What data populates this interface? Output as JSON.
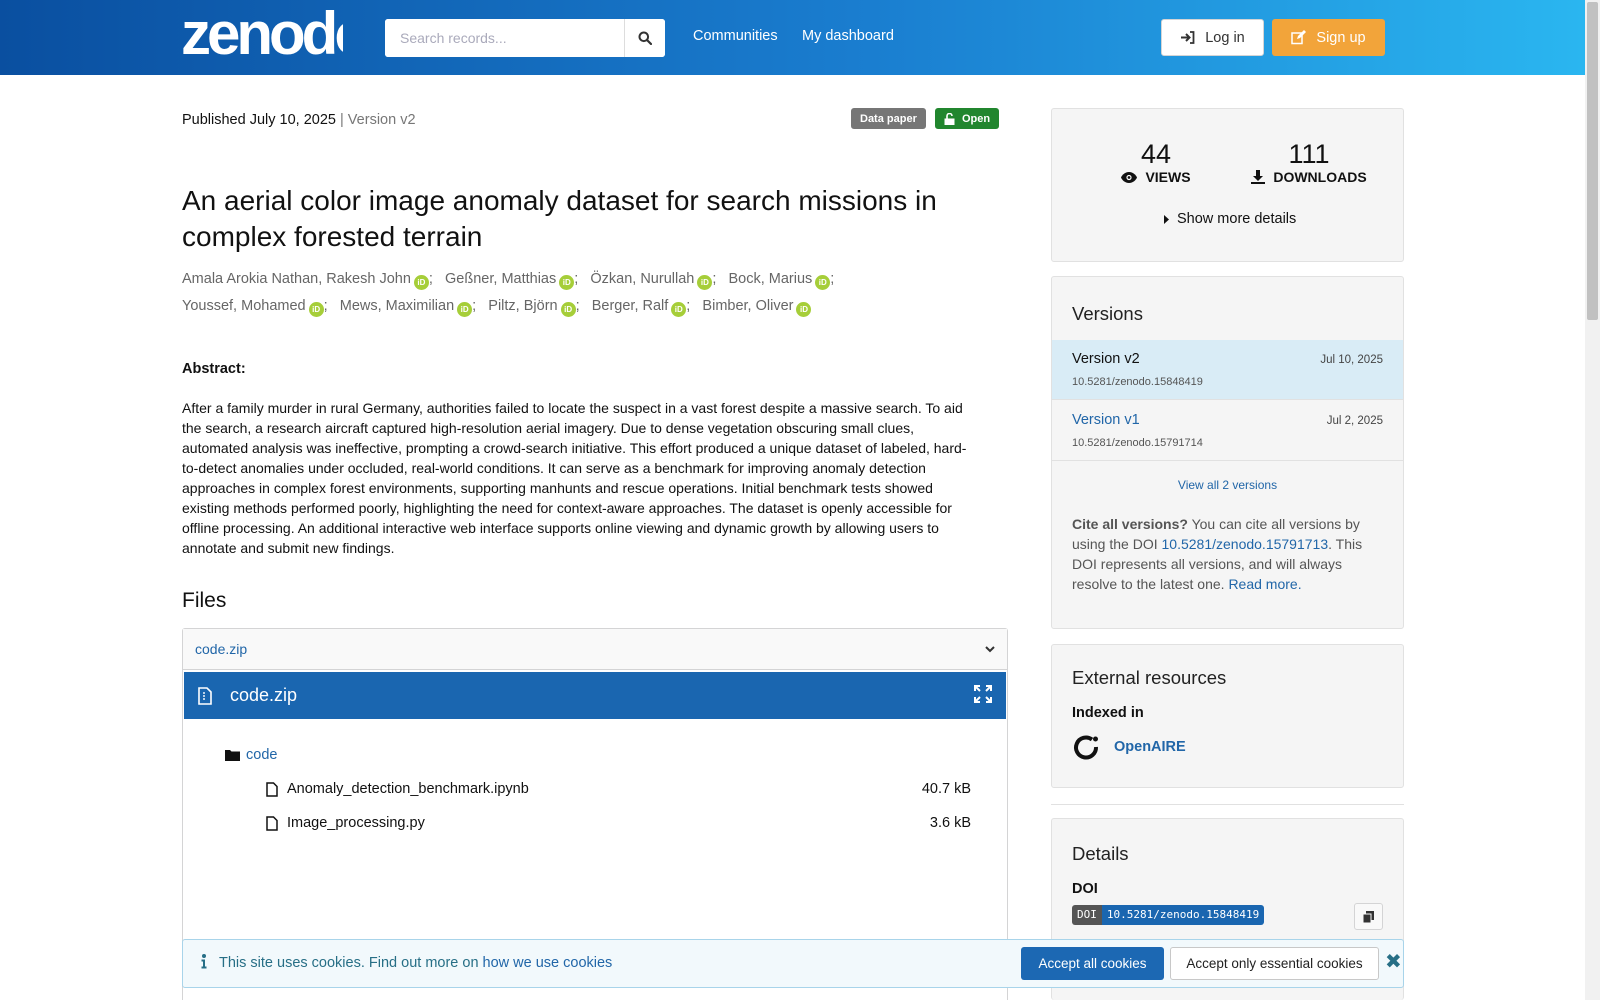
{
  "header": {
    "logo_text": "zenodo",
    "search_placeholder": "Search records...",
    "nav": [
      "Communities",
      "My dashboard"
    ],
    "login_label": "Log in",
    "signup_label": "Sign up"
  },
  "record": {
    "published": "Published July 10, 2025",
    "version": "| Version v2",
    "type_badge": "Data paper",
    "access_badge": "Open",
    "title": "An aerial color image anomaly dataset for search missions in complex forested terrain",
    "authors": [
      "Amala Arokia Nathan, Rakesh John",
      "Geßner, Matthias",
      "Özkan, Nurullah",
      "Bock, Marius",
      "Youssef, Mohamed",
      "Mews, Maximilian",
      "Piltz, Björn",
      "Berger, Ralf",
      "Bimber, Oliver"
    ],
    "abstract_label": "Abstract:",
    "abstract": "After a family murder in rural Germany, authorities failed to locate the suspect in a vast forest despite a massive search. To aid the search, a research aircraft captured high-resolution aerial imagery. Due to dense vegetation obscuring small clues, automated analysis was ineffective, prompting a crowd-search initiative. This effort produced a unique dataset of labeled, hard-to-detect anomalies under occluded, real-world conditions. It can serve as a benchmark for improving anomaly detection approaches in complex forest environments, supporting manhunts and rescue operations. Initial benchmark tests showed existing methods performed poorly, highlighting the need for context-aware approaches. The dataset is openly accessible for offline processing. An additional interactive web interface supports online viewing and dynamic growth by allowing users to annotate and submit new findings."
  },
  "files": {
    "heading": "Files",
    "accordion_label": "code.zip",
    "preview_title": "code.zip",
    "folder": "code",
    "items": [
      {
        "name": "Anomaly_detection_benchmark.ipynb",
        "size": "40.7 kB"
      },
      {
        "name": "Image_processing.py",
        "size": "3.6 kB"
      }
    ]
  },
  "stats": {
    "views": "44",
    "views_label": "VIEWS",
    "downloads": "111",
    "downloads_label": "DOWNLOADS",
    "more": "Show more details"
  },
  "versions": {
    "heading": "Versions",
    "list": [
      {
        "name": "Version v2",
        "date": "Jul 10, 2025",
        "doi": "10.5281/zenodo.15848419"
      },
      {
        "name": "Version v1",
        "date": "Jul 2, 2025",
        "doi": "10.5281/zenodo.15791714"
      }
    ],
    "view_all": "View all 2 versions",
    "cite_bold": "Cite all versions?",
    "cite_text1": " You can cite all versions by using the DOI ",
    "cite_doi": "10.5281/zenodo.15791713",
    "cite_text2": ". This DOI represents all versions, and will always resolve to the latest one. ",
    "read_more": "Read more."
  },
  "external": {
    "heading": "External resources",
    "indexed_in": "Indexed in",
    "source": "OpenAIRE"
  },
  "details": {
    "heading": "Details",
    "doi_label": "DOI",
    "doi_key": "DOI",
    "doi_value": "10.5281/zenodo.15848419"
  },
  "cookies": {
    "text": "This site uses cookies. Find out more on ",
    "link": "how we use cookies",
    "accept_all": "Accept all cookies",
    "accept_essential": "Accept only essential cookies"
  },
  "colors": {
    "brand_blue": "#1a66b0",
    "signup_orange": "#f2a43a",
    "open_green": "#21862e",
    "orcid_green": "#a6ce39"
  }
}
